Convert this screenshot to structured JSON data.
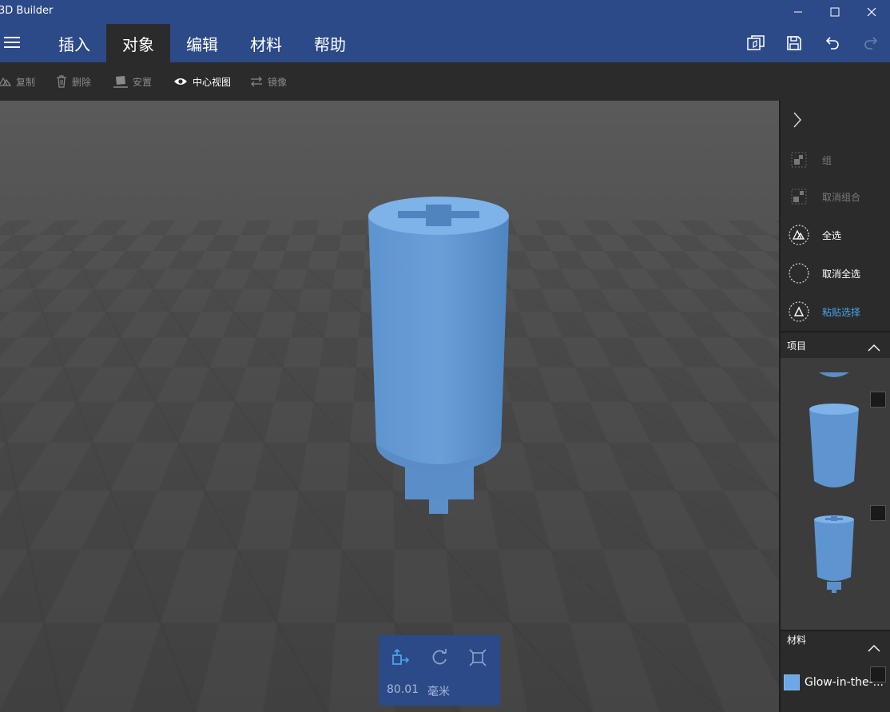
{
  "app": {
    "title": "3D Builder"
  },
  "menu": {
    "tabs": [
      {
        "label": "插入"
      },
      {
        "label": "对象"
      },
      {
        "label": "编辑"
      },
      {
        "label": "材料"
      },
      {
        "label": "帮助"
      }
    ],
    "active_tab": "对象"
  },
  "toolbar": {
    "items": [
      {
        "label": "复制",
        "icon": "copy-icon",
        "enabled": false
      },
      {
        "label": "删除",
        "icon": "trash-icon",
        "enabled": false
      },
      {
        "label": "安置",
        "icon": "place-icon",
        "enabled": false
      },
      {
        "label": "中心视图",
        "icon": "eye-icon",
        "enabled": true
      },
      {
        "label": "镜像",
        "icon": "mirror-icon",
        "enabled": false
      }
    ]
  },
  "right_panel": {
    "actions": [
      {
        "label": "组",
        "icon": "group-icon",
        "state": "disabled"
      },
      {
        "label": "取消组合",
        "icon": "ungroup-icon",
        "state": "disabled"
      },
      {
        "label": "全选",
        "icon": "select-all-icon",
        "state": "enabled"
      },
      {
        "label": "取消全选",
        "icon": "deselect-icon",
        "state": "enabled"
      },
      {
        "label": "粘贴选择",
        "icon": "paste-selection-icon",
        "state": "accent"
      }
    ],
    "items_section": {
      "title": "项目"
    },
    "material_section": {
      "title": "材料",
      "material_name": "Glow-in-the-..."
    }
  },
  "transform_panel": {
    "value": "80.01",
    "unit": "毫米"
  },
  "colors": {
    "titlebar": "#2b4a87",
    "toolbar": "#2b2b2b",
    "accent": "#4aa3e8",
    "model": "#5b93cf"
  }
}
